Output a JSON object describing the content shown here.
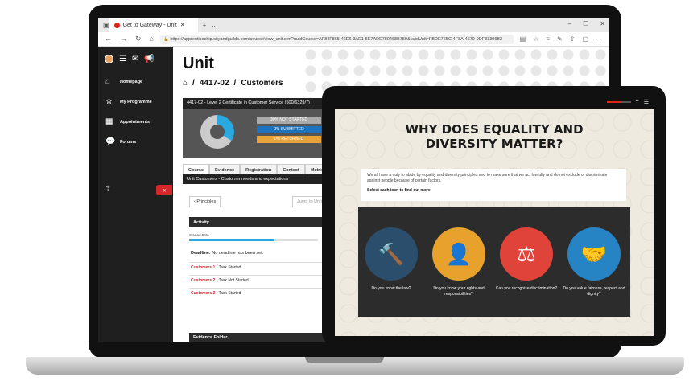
{
  "browser": {
    "tab_title": "Get to Gateway - Unit",
    "url": "https://apprenticeship.cityandguilds.com/course/view_unit.cfm?uuidCourse=AF84F865-46E6-3AE1-5E7ADE780468B759&uuidUnit=FBDE765C-4F8A-4679-9DF33306B2"
  },
  "sidebar": {
    "items": [
      {
        "label": "Homepage",
        "icon": "home-icon"
      },
      {
        "label": "My Programme",
        "icon": "star-icon"
      },
      {
        "label": "Appointments",
        "icon": "calendar-icon"
      },
      {
        "label": "Forums",
        "icon": "chat-icon"
      }
    ],
    "collapse_label": "«"
  },
  "main": {
    "title": "Unit",
    "breadcrumb": [
      "4417-02",
      "Customers"
    ],
    "card_title": "4417-02 - Level 2 Certificate in Customer Service (500/6329/7)",
    "stats": [
      "30% NOT STARTED",
      "0% SUBMITTED",
      "0% RETURNED"
    ],
    "tabs": [
      "Course",
      "Evidence",
      "Registration",
      "Contact",
      "Metrics"
    ],
    "unit_heading": "Unit Customers - Customer needs and expectations",
    "prev_label": "‹ Principles",
    "jump_placeholder": "Jump to Unit",
    "activity_label": "Activity",
    "progress_label": "Started 66%",
    "progress": 0.66,
    "deadline_label": "Deadline:",
    "deadline_value": "No deadline has been set.",
    "tasks": [
      {
        "name": "Customers.1",
        "status": "- Task Started"
      },
      {
        "name": "Customers.2",
        "status": "- Task Not Started"
      },
      {
        "name": "Customers.3",
        "status": "- Task Started"
      }
    ],
    "evidence_label": "Evidence Folder"
  },
  "tablet": {
    "headline_1": "WHY DOES EQUALITY AND",
    "headline_2": "DIVERSITY MATTER?",
    "intro": "We all have a duty to abide by equality and diversity principles and to make sure that we act lawfully and do not exclude or discriminate against people because of certain factors.",
    "instruction": "Select each icon to find out more.",
    "topics": [
      {
        "caption": "Do you know the law?",
        "icon": "gavel-icon"
      },
      {
        "caption": "Do you know your rights and responsibilities?",
        "icon": "person-icon"
      },
      {
        "caption": "Can you recognise discrimination?",
        "icon": "scales-icon"
      },
      {
        "caption": "Do you value fairness, respect and dignity?",
        "icon": "hands-icon"
      }
    ]
  }
}
